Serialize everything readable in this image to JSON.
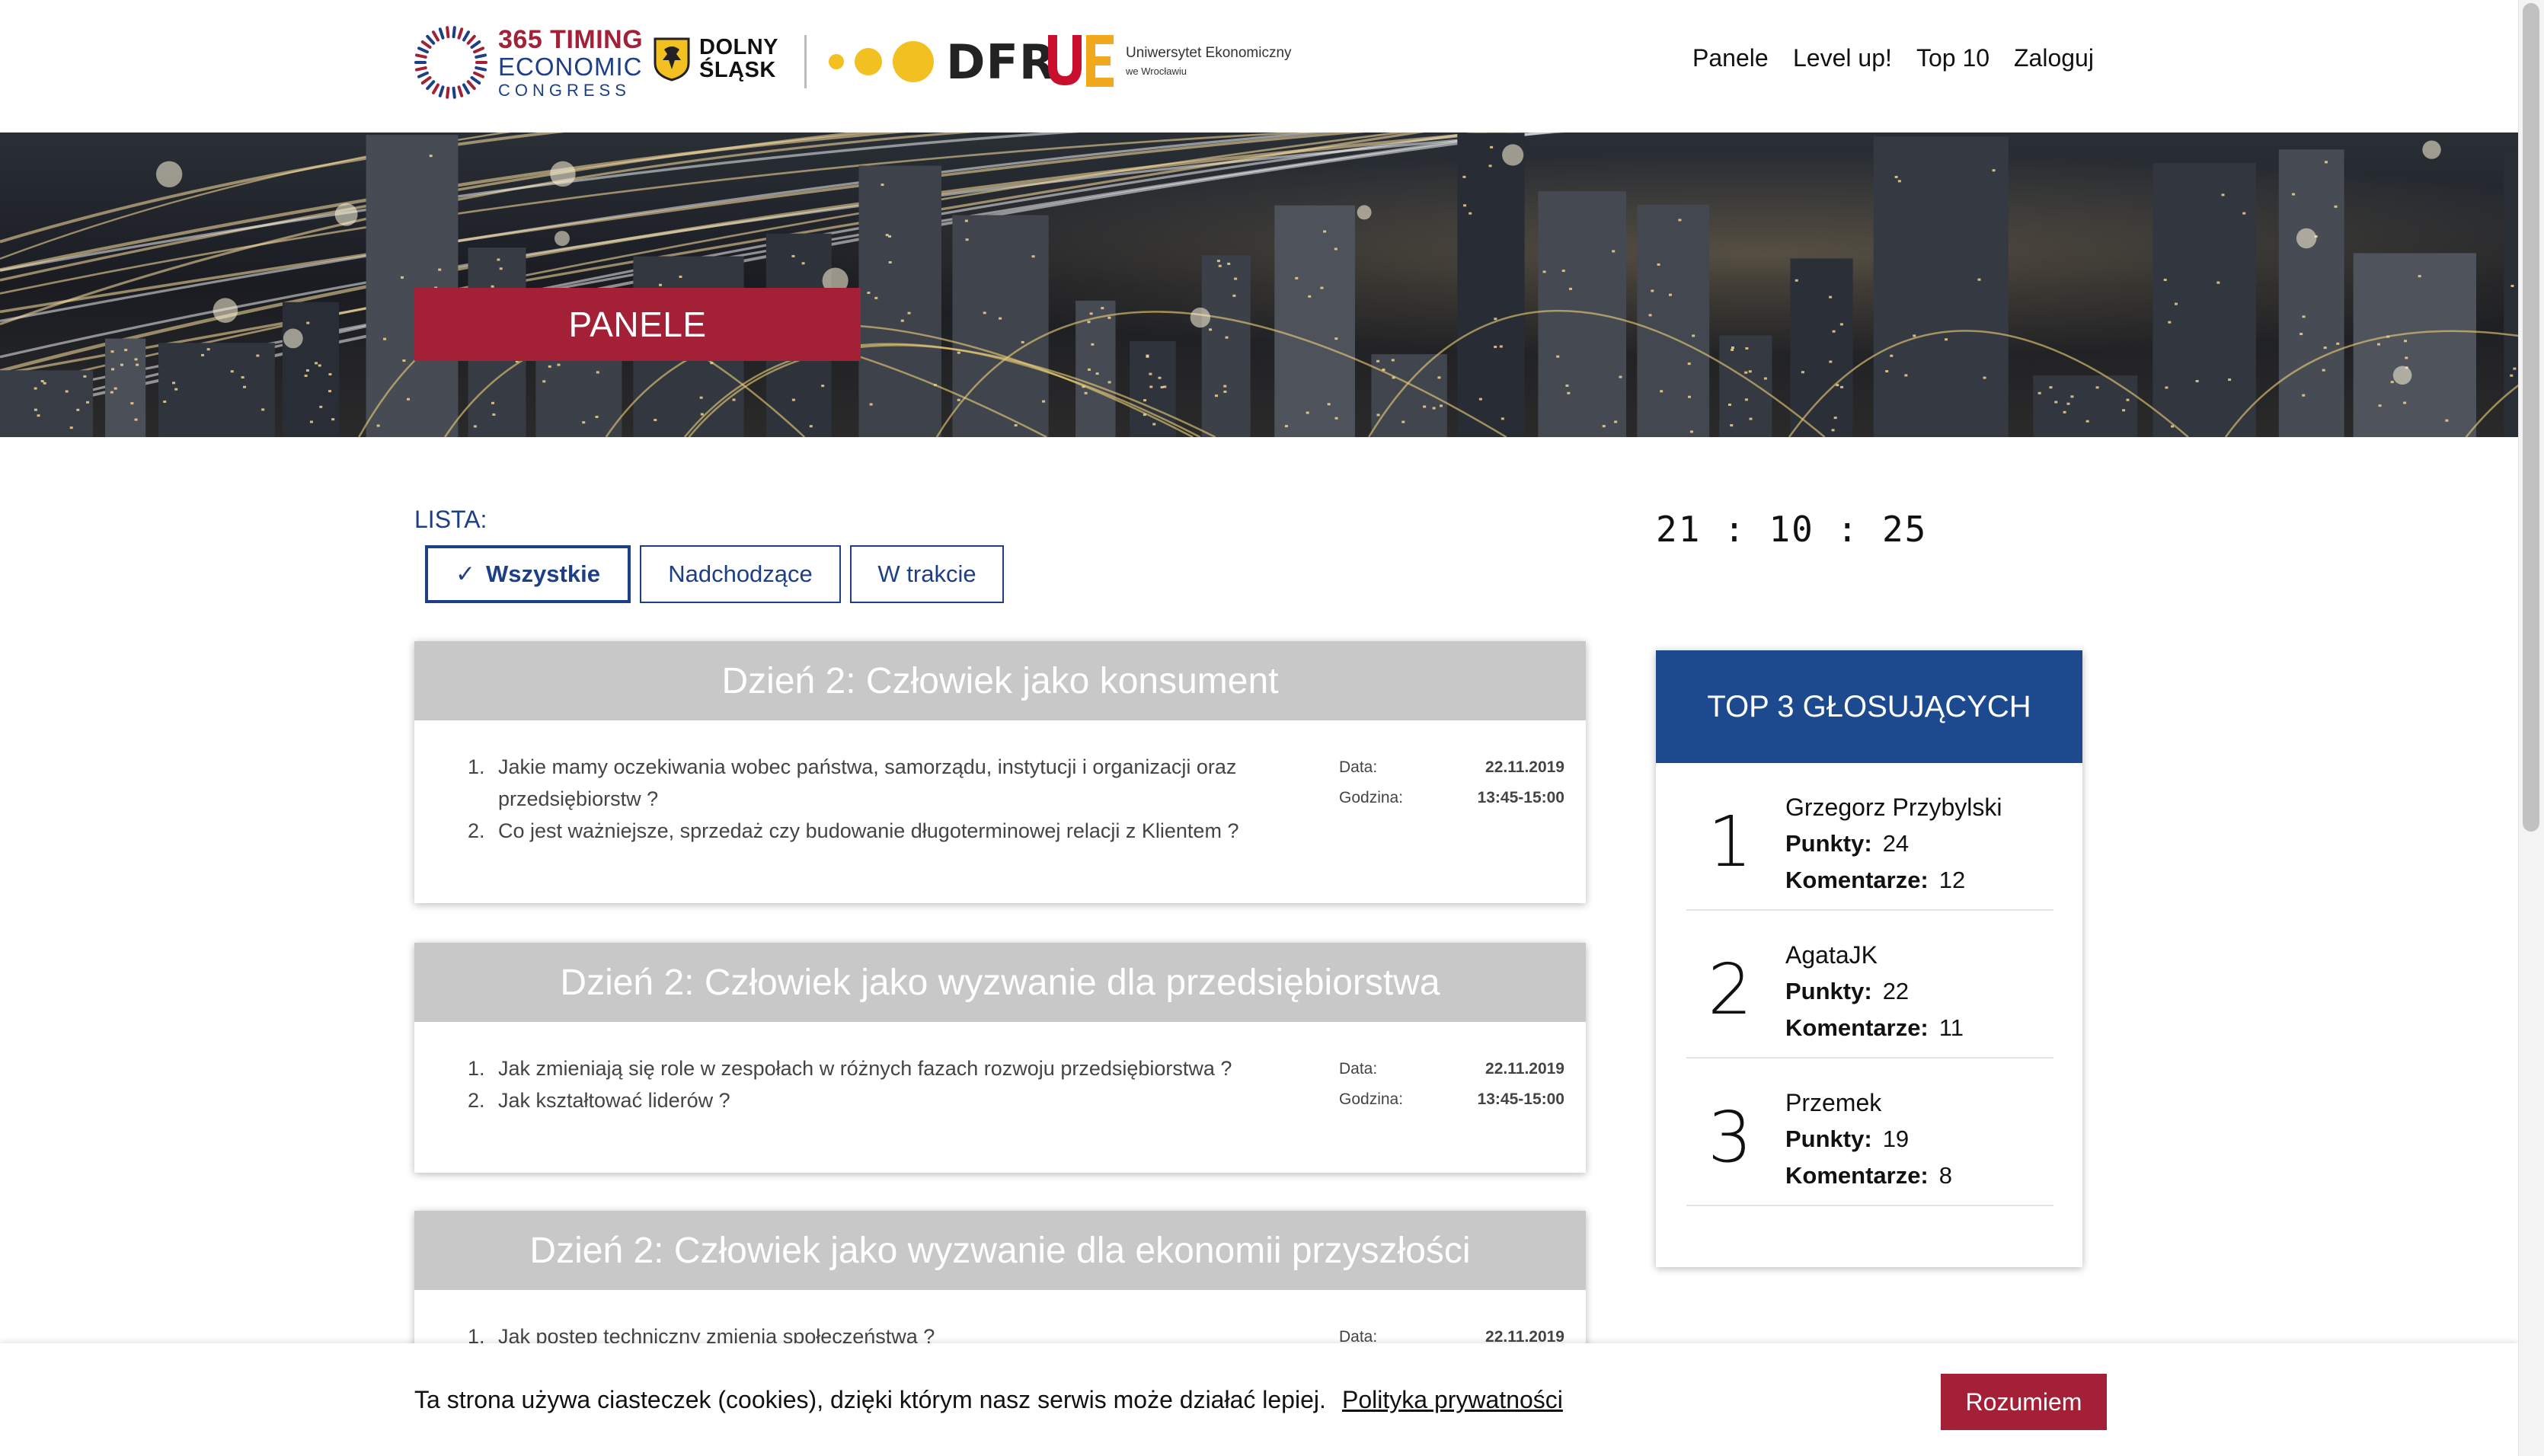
{
  "header": {
    "logo_365": {
      "line1": "365 TIMING",
      "line2": "ECONOMIC",
      "line3": "CONGRESS"
    },
    "logo_ds": {
      "line1": "DOLNY",
      "line2": "ŚLĄSK"
    },
    "logo_dfr": {
      "text": "DFR"
    },
    "logo_ue": {
      "line1": "Uniwersytet Ekonomiczny",
      "line2": "we Wrocławiu",
      "mark": "UE"
    },
    "nav": [
      {
        "label": "Panele"
      },
      {
        "label": "Level up!"
      },
      {
        "label": "Top 10"
      },
      {
        "label": "Zaloguj"
      }
    ]
  },
  "banner": {
    "title": "PANELE"
  },
  "lista": {
    "label": "LISTA:",
    "filters": [
      {
        "label": "Wszystkie",
        "active": true,
        "check": "✓"
      },
      {
        "label": "Nadchodzące",
        "active": false
      },
      {
        "label": "W trakcie",
        "active": false
      }
    ]
  },
  "clock": "21 : 10 : 25",
  "panels": [
    {
      "title": "Dzień 2: Człowiek jako konsument",
      "questions": [
        {
          "num": "1.",
          "text_a": "Jakie mamy oczekiwania wobec państwa, samorządu, instytucji i organizacji oraz",
          "text_b": "przedsiębiorstw ?"
        },
        {
          "num": "2.",
          "text_a": "Co jest ważniejsze, sprzedaż czy budowanie długoterminowej relacji z Klientem ?"
        }
      ],
      "date_label": "Data:",
      "date": "22.11.2019",
      "time_label": "Godzina:",
      "time": "13:45-15:00"
    },
    {
      "title": "Dzień 2: Człowiek jako wyzwanie dla przedsiębiorstwa",
      "questions": [
        {
          "num": "1.",
          "text_a": "Jak zmieniają się role w zespołach w różnych fazach rozwoju przedsiębiorstwa ?"
        },
        {
          "num": "2.",
          "text_a": "Jak kształtować liderów ?"
        }
      ],
      "date_label": "Data:",
      "date": "22.11.2019",
      "time_label": "Godzina:",
      "time": "13:45-15:00"
    },
    {
      "title": "Dzień 2: Człowiek jako wyzwanie dla ekonomii przyszłości",
      "questions": [
        {
          "num": "1.",
          "text_a": "Jak postęp techniczny zmienia społeczeństwa ?"
        }
      ],
      "date_label": "Data:",
      "date": "22.11.2019"
    }
  ],
  "top3": {
    "title": "TOP 3 GŁOSUJĄCYCH",
    "points_label": "Punkty:",
    "comments_label": "Komentarze:",
    "voters": [
      {
        "rank": "1",
        "name": "Grzegorz Przybylski",
        "points": "24",
        "comments": "12"
      },
      {
        "rank": "2",
        "name": "AgataJK",
        "points": "22",
        "comments": "11"
      },
      {
        "rank": "3",
        "name": "Przemek",
        "points": "19",
        "comments": "8"
      }
    ]
  },
  "cookie": {
    "text": "Ta strona używa ciasteczek (cookies), dzięki którym nasz serwis może działać lepiej.",
    "link": "Polityka prywatności",
    "button": "Rozumiem"
  },
  "colors": {
    "brand_red": "#a32036",
    "brand_blue": "#1d3f86",
    "top_blue": "#1d4a8e",
    "card_gray": "#c8c8c8",
    "dot_yellow": "#f2c020"
  }
}
